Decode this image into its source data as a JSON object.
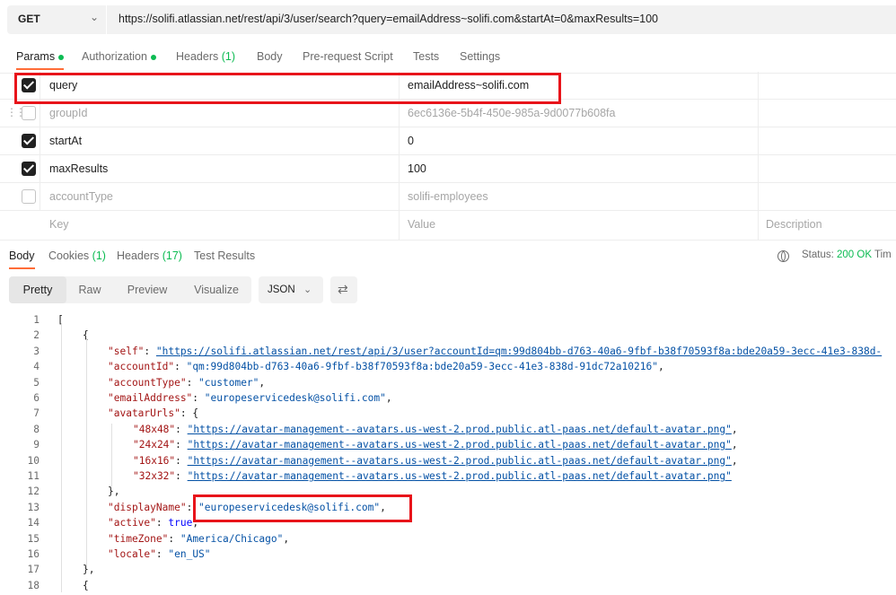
{
  "request": {
    "method": "GET",
    "url": "https://solifi.atlassian.net/rest/api/3/user/search?query=emailAddress~solifi.com&startAt=0&maxResults=100"
  },
  "request_tabs": [
    {
      "label": "Params",
      "active": true,
      "dot": true
    },
    {
      "label": "Authorization",
      "dot": true
    },
    {
      "label": "Headers",
      "count": "(1)"
    },
    {
      "label": "Body"
    },
    {
      "label": "Pre-request Script"
    },
    {
      "label": "Tests"
    },
    {
      "label": "Settings"
    }
  ],
  "params": [
    {
      "key": "query",
      "value": "emailAddress~solifi.com",
      "checked": true
    },
    {
      "key": "groupId",
      "value": "6ec6136e-5b4f-450e-985a-9d0077b608fa",
      "checked": false
    },
    {
      "key": "startAt",
      "value": "0",
      "checked": true
    },
    {
      "key": "maxResults",
      "value": "100",
      "checked": true
    },
    {
      "key": "accountType",
      "value": "solifi-employees",
      "checked": false
    }
  ],
  "params_placeholder": {
    "key": "Key",
    "value": "Value",
    "description": "Description"
  },
  "response_tabs": [
    {
      "label": "Body",
      "active": true
    },
    {
      "label": "Cookies",
      "count": "(1)"
    },
    {
      "label": "Headers",
      "count": "(17)"
    },
    {
      "label": "Test Results"
    }
  ],
  "status": {
    "label": "Status:",
    "value": "200 OK",
    "trailing": "Tim"
  },
  "view_modes": [
    "Pretty",
    "Raw",
    "Preview",
    "Visualize"
  ],
  "format": "JSON",
  "code_lines": [
    {
      "n": "1",
      "t": "["
    },
    {
      "n": "2",
      "t": "    {"
    },
    {
      "n": "3",
      "k": "\"self\"",
      "u": "\"https://solifi.atlassian.net/rest/api/3/user?accountId=qm:99d804bb-d763-40a6-9fbf-b38f70593f8a:bde20a59-3ecc-41e3-838d-"
    },
    {
      "n": "4",
      "k": "\"accountId\"",
      "s": "\"qm:99d804bb-d763-40a6-9fbf-b38f70593f8a:bde20a59-3ecc-41e3-838d-91dc72a10216\"",
      "e": ","
    },
    {
      "n": "5",
      "k": "\"accountType\"",
      "s": "\"customer\"",
      "e": ","
    },
    {
      "n": "6",
      "k": "\"emailAddress\"",
      "s": "\"europeservicedesk@solifi.com\"",
      "e": ","
    },
    {
      "n": "7",
      "k": "\"avatarUrls\"",
      "o": "{"
    },
    {
      "n": "8",
      "k": "\"48x48\"",
      "u": "\"https://avatar-management--avatars.us-west-2.prod.public.atl-paas.net/default-avatar.png\"",
      "e": ","
    },
    {
      "n": "9",
      "k": "\"24x24\"",
      "u": "\"https://avatar-management--avatars.us-west-2.prod.public.atl-paas.net/default-avatar.png\"",
      "e": ","
    },
    {
      "n": "10",
      "k": "\"16x16\"",
      "u": "\"https://avatar-management--avatars.us-west-2.prod.public.atl-paas.net/default-avatar.png\"",
      "e": ","
    },
    {
      "n": "11",
      "k": "\"32x32\"",
      "u": "\"https://avatar-management--avatars.us-west-2.prod.public.atl-paas.net/default-avatar.png\""
    },
    {
      "n": "12",
      "t": "},"
    },
    {
      "n": "13",
      "k": "\"displayName\"",
      "s": "\"europeservicedesk@solifi.com\"",
      "e": ","
    },
    {
      "n": "14",
      "k": "\"active\"",
      "b": "true",
      "e": ","
    },
    {
      "n": "15",
      "k": "\"timeZone\"",
      "s": "\"America/Chicago\"",
      "e": ","
    },
    {
      "n": "16",
      "k": "\"locale\"",
      "s": "\"en_US\""
    },
    {
      "n": "17",
      "t": "},"
    },
    {
      "n": "18",
      "t": "{"
    }
  ],
  "highlight_color": "#e8141a",
  "accent_color": "#ff6c37",
  "icons": [
    "chevron-down-icon",
    "drag-handle-icon",
    "checkbox-icon",
    "globe-icon",
    "wrap-icon"
  ]
}
